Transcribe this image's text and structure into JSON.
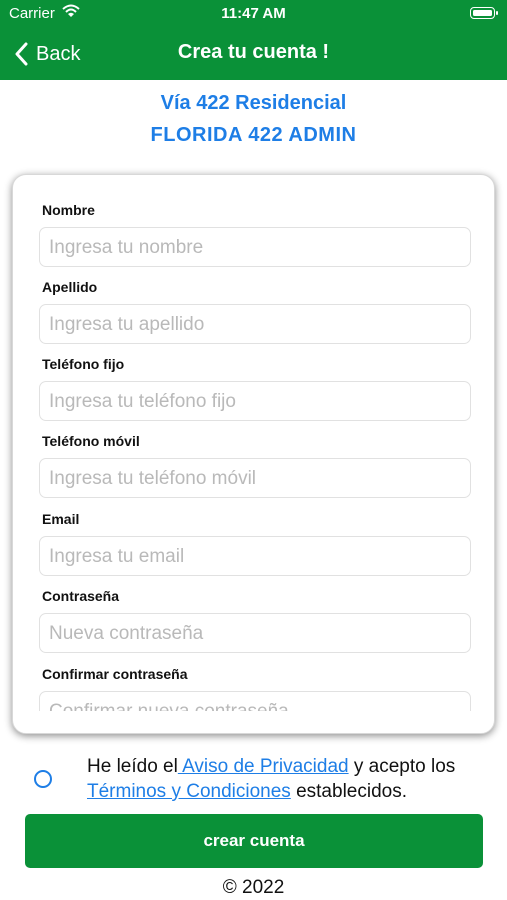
{
  "status_bar": {
    "carrier": "Carrier",
    "time": "11:47 AM"
  },
  "nav": {
    "back_label": "Back",
    "title": "Crea tu cuenta !"
  },
  "org": {
    "name": "Vía 422 Residencial",
    "subtitle": "FLORIDA  422  ADMIN"
  },
  "form": {
    "fields": [
      {
        "label": "Nombre",
        "placeholder": "Ingresa tu nombre"
      },
      {
        "label": "Apellido",
        "placeholder": "Ingresa tu apellido"
      },
      {
        "label": "Teléfono fijo",
        "placeholder": "Ingresa tu teléfono fijo"
      },
      {
        "label": "Teléfono móvil",
        "placeholder": "Ingresa tu teléfono móvil"
      },
      {
        "label": "Email",
        "placeholder": "Ingresa tu email"
      },
      {
        "label": "Contraseña",
        "placeholder": "Nueva contraseña"
      },
      {
        "label": "Confirmar contraseña",
        "placeholder": "Confirmar nueva contraseña"
      }
    ]
  },
  "terms": {
    "prefix": "He leído el",
    "privacy_link": " Aviso de Privacidad",
    "middle": " y acepto los",
    "terms_link": " Términos y Condiciones",
    "suffix": " establecidos."
  },
  "create_button": "crear cuenta",
  "footer": {
    "copyright": "© 2022"
  },
  "colors": {
    "brand_green": "#0a9138",
    "link_blue": "#1e7ee6"
  }
}
